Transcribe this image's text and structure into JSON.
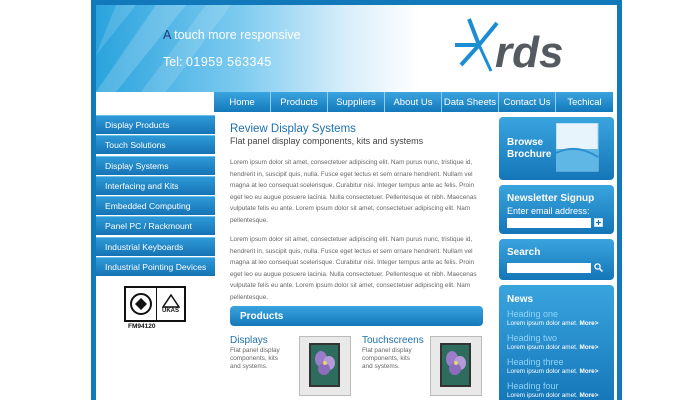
{
  "header": {
    "tagline_first": "A",
    "tagline_rest": " touch more responsive",
    "phone_label": "Tel:",
    "phone_number": "01959 563345",
    "logo_text": "rds"
  },
  "nav": [
    {
      "label": "Home"
    },
    {
      "label": "Products"
    },
    {
      "label": "Suppliers"
    },
    {
      "label": "About Us"
    },
    {
      "label": "Data Sheets"
    },
    {
      "label": "Contact Us"
    },
    {
      "label": "Techical"
    }
  ],
  "sidebar": [
    {
      "label": "Display Products"
    },
    {
      "label": "Touch Solutions"
    },
    {
      "label": "Display Systems"
    },
    {
      "label": "Interfacing and Kits"
    },
    {
      "label": "Embedded Computing"
    },
    {
      "label": "Panel PC / Rackmount"
    },
    {
      "label": "Industrial Keyboards"
    },
    {
      "label": "Industrial Pointing Devices"
    }
  ],
  "certification": {
    "badge_left": "BSI",
    "badge_right": "UKAS",
    "code": "FM94120"
  },
  "main": {
    "title": "Review Display Systems",
    "subtitle": "Flat panel display components, kits and systems",
    "para1": "Lorem ipsum dolor sit amet, consectetuer adipiscing elit. Nam purus nunc, tristique id, hendrerit in, suscipit quis, nulla. Fusce eget lectus et sem ornare hendrerit. Nullam vel magna at leo consequat scelerisque. Curabitur nisi. Integer tempus ante ac felis. Proin eget leo eu augue posuere lacinia. Nulla consectetuer. Pellentesque et nibh. Maecenas vulputate felis eu ante. Lorem ipsum dolor sit amet, consectetuer adipiscing elit. Nam pellentesque.",
    "para2": "Lorem ipsum dolor sit amet, consectetuer adipiscing elit. Nam purus nunc, tristique id, hendrerit in, suscipit quis, nulla. Fusce eget lectus et sem ornare hendrerit. Nullam vel magna at leo consequat scelerisque. Curabitur nisi. Integer tempus ante ac felis. Proin eget leo eu augue posuere lacinia. Nulla consectetuer. Pellentesque et nibh. Maecenas vulputate felis eu ante. Lorem ipsum dolor sit amet, consectetuer adipiscing elit. Nam pellentesque."
  },
  "products": {
    "heading": "Products",
    "items": [
      {
        "name": "Displays",
        "desc": "Flat panel display components, kits and systems."
      },
      {
        "name": "Touchscreens",
        "desc": "Flat panel display components, kits and systems."
      }
    ]
  },
  "right": {
    "brochure_line1": "Browse",
    "brochure_line2": "Brochure",
    "newsletter_title": "Newsletter Signup",
    "newsletter_label": "Enter email address:",
    "search_title": "Search",
    "news_title": "News",
    "news": [
      {
        "heading": "Heading one",
        "text": "Lorem ipsum dolor amet.",
        "more": "More>"
      },
      {
        "heading": "Heading two",
        "text": "Lorem ipsum dolor amet.",
        "more": "More>"
      },
      {
        "heading": "Heading three",
        "text": "Lorem ipsum dolor amet.",
        "more": "More>"
      },
      {
        "heading": "Heading four",
        "text": "Lorem ipsum dolor amet.",
        "more": "More>"
      }
    ]
  },
  "colors": {
    "brand_blue": "#1178b9",
    "nav_light": "#3aa4df",
    "title_blue": "#1d70b0"
  }
}
